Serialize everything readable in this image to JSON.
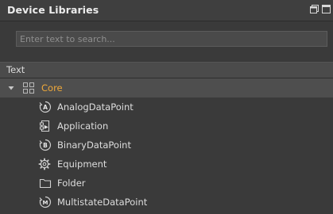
{
  "panel": {
    "title": "Device Libraries"
  },
  "search": {
    "placeholder": "Enter text to search..."
  },
  "column_header": {
    "label": "Text"
  },
  "tree": {
    "root": {
      "label": "Core",
      "expanded": true,
      "icon": "grid-icon",
      "color": "#f0a93a"
    },
    "children": [
      {
        "label": "AnalogDataPoint",
        "icon": "analog-datapoint-icon"
      },
      {
        "label": "Application",
        "icon": "application-icon"
      },
      {
        "label": "BinaryDataPoint",
        "icon": "binary-datapoint-icon"
      },
      {
        "label": "Equipment",
        "icon": "equipment-gear-icon"
      },
      {
        "label": "Folder",
        "icon": "folder-icon"
      },
      {
        "label": "MultistateDataPoint",
        "icon": "multistate-datapoint-icon"
      }
    ]
  }
}
